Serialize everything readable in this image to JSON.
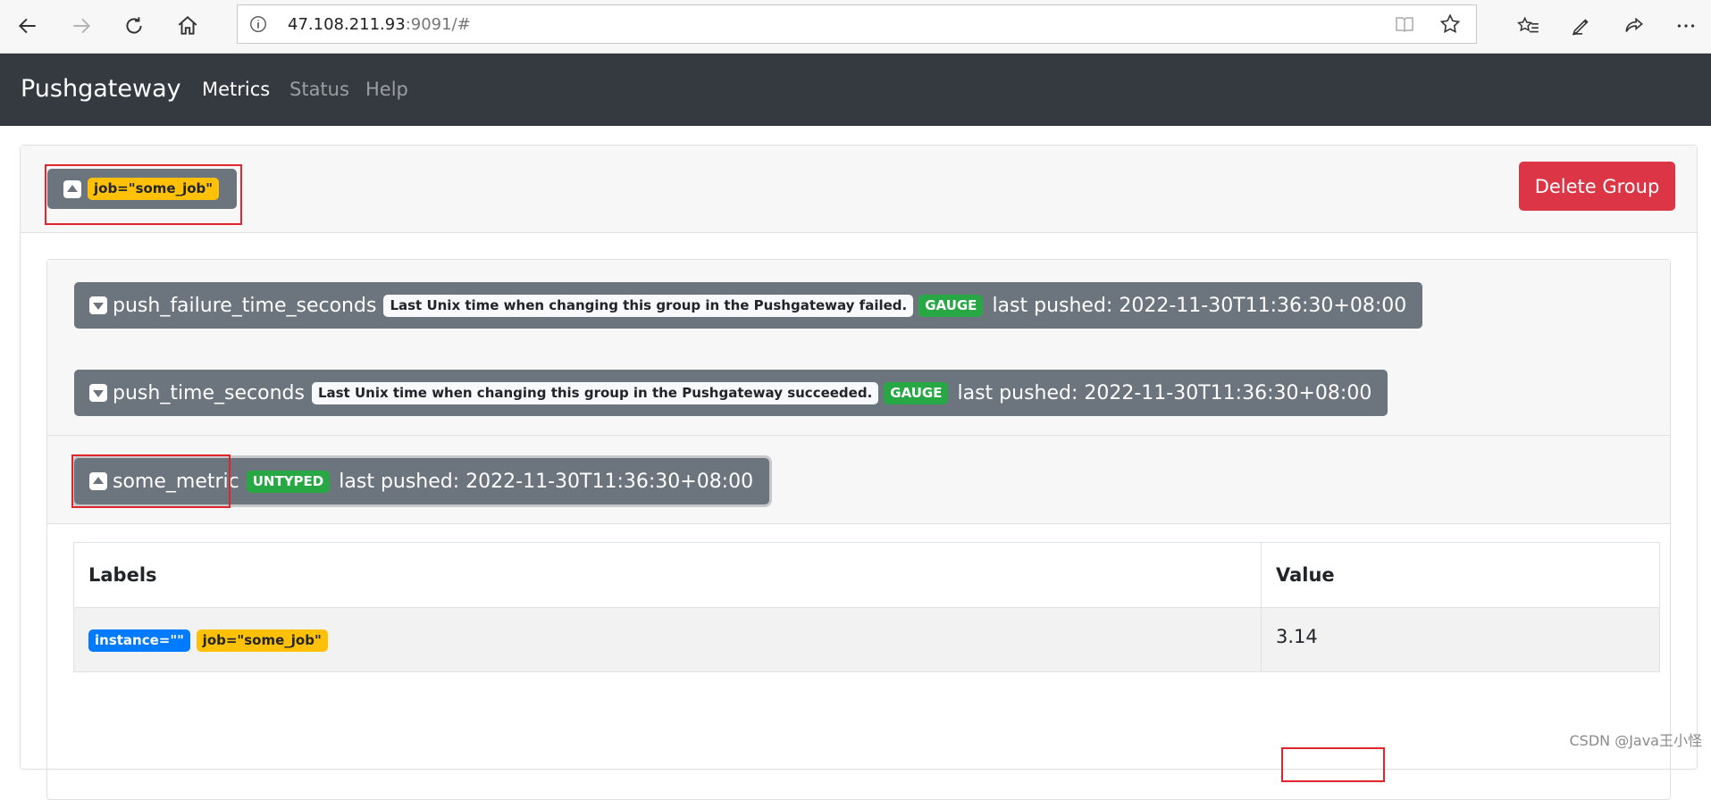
{
  "browser": {
    "url_host": "47.108.211.93",
    "url_rest": ":9091/#"
  },
  "navbar": {
    "brand": "Pushgateway",
    "links": [
      "Metrics",
      "Status",
      "Help"
    ]
  },
  "group": {
    "label_badge": "job=\"some_job\"",
    "delete_label": "Delete Group"
  },
  "metrics": [
    {
      "name": "push_failure_time_seconds",
      "help": "Last Unix time when changing this group in the Pushgateway failed.",
      "type": "GAUGE",
      "pushed": "last pushed: 2022-11-30T11:36:30+08:00"
    },
    {
      "name": "push_time_seconds",
      "help": "Last Unix time when changing this group in the Pushgateway succeeded.",
      "type": "GAUGE",
      "pushed": "last pushed: 2022-11-30T11:36:30+08:00"
    },
    {
      "name": "some_metric",
      "type": "UNTYPED",
      "pushed": "last pushed: 2022-11-30T11:36:30+08:00"
    }
  ],
  "table": {
    "headers": [
      "Labels",
      "Value"
    ],
    "rows": [
      {
        "labels": [
          "instance=\"\"",
          "job=\"some_job\""
        ],
        "value": "3.14"
      }
    ]
  },
  "watermark": "CSDN @Java王小怪",
  "colors": {
    "navbar": "#343a40",
    "secondary": "#6c757d",
    "danger": "#dc3545",
    "warning": "#ffc107",
    "success": "#28a745",
    "primary": "#007bff",
    "highlight_box": "#e0262c"
  }
}
